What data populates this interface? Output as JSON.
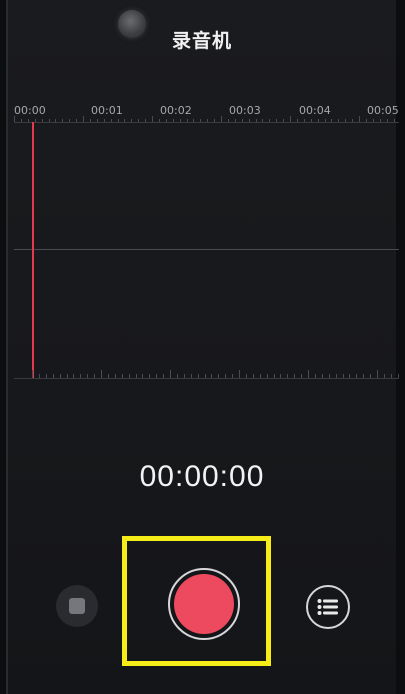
{
  "app": {
    "title": "录音机"
  },
  "ruler": {
    "ticks": [
      "00:00",
      "00:01",
      "00:02",
      "00:03",
      "00:04",
      "00:05"
    ]
  },
  "recorder": {
    "elapsed": "00:00:00",
    "accent": "#ee4a5f"
  },
  "icons": {
    "stop": "stop-icon",
    "record": "record-icon",
    "list": "list-icon"
  }
}
